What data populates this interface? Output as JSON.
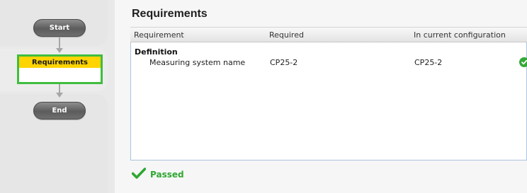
{
  "wizard": {
    "steps": [
      {
        "label": "Start"
      },
      {
        "label": "Requirements"
      },
      {
        "label": "End"
      }
    ]
  },
  "main": {
    "title": "Requirements",
    "columns": [
      "Requirement",
      "Required",
      "In current configuration"
    ],
    "group": "Definition",
    "rows": [
      {
        "name": "Measuring system name",
        "required": "CP25-2",
        "current": "CP25-2",
        "status_icon": "check-icon"
      }
    ],
    "result": {
      "label": "Passed",
      "icon": "checkmark-icon"
    }
  },
  "colors": {
    "active_step": "#ffd400",
    "active_border": "#3fbd3f",
    "success": "#2fa732"
  }
}
